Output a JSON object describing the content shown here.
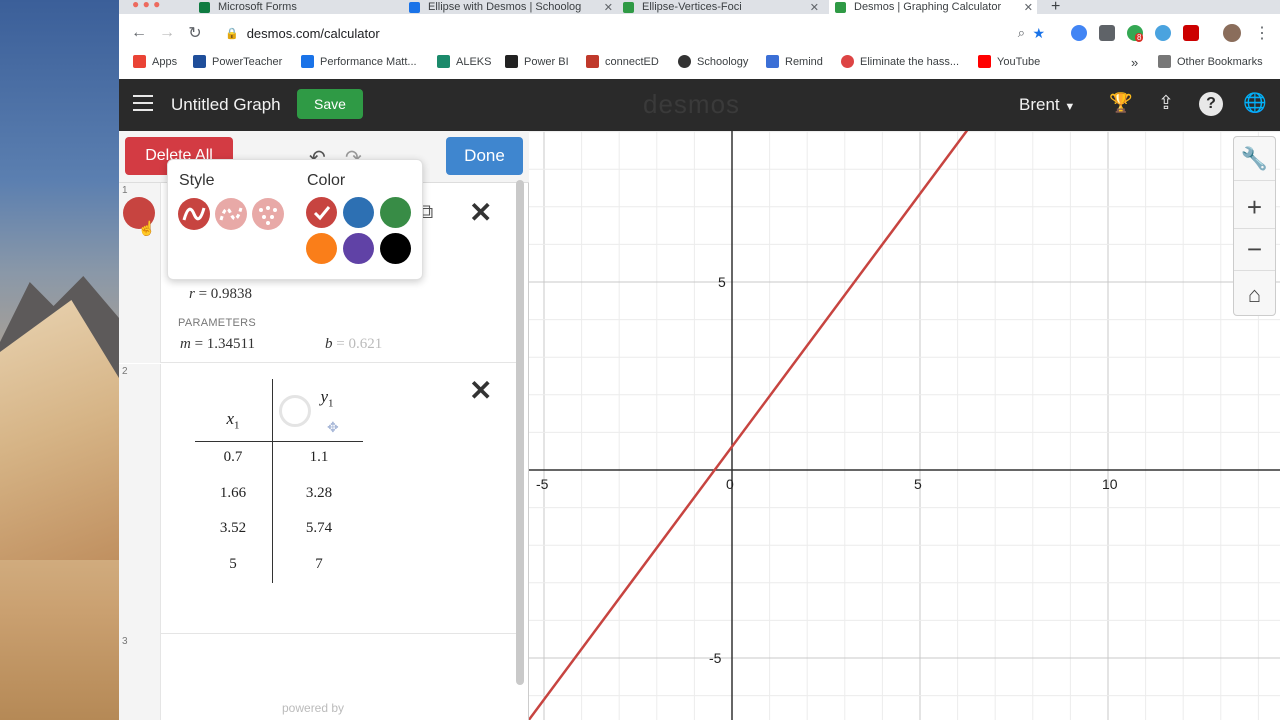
{
  "browser": {
    "tabs": [
      {
        "label": "Microsoft Forms",
        "color": "#0f7b41"
      },
      {
        "label": "Ellipse with Desmos | Schoolog",
        "color": "#1a73e8"
      },
      {
        "label": "Ellipse-Vertices-Foci",
        "color": "#2f9a45"
      },
      {
        "label": "Desmos | Graphing Calculator",
        "color": "#2f9a45"
      }
    ],
    "url": "desmos.com/calculator",
    "bookmarks": [
      {
        "label": "Apps",
        "color": "#ea4335"
      },
      {
        "label": "PowerTeacher",
        "color": "#1f4e9a"
      },
      {
        "label": "Performance Matt...",
        "color": "#1a73e8"
      },
      {
        "label": "ALEKS",
        "color": "#1b8a6b"
      },
      {
        "label": "Power BI",
        "color": "#222222"
      },
      {
        "label": "connectED",
        "color": "#c0392b"
      },
      {
        "label": "Schoology",
        "color": "#333333"
      },
      {
        "label": "Remind",
        "color": "#3b6fd6"
      },
      {
        "label": "Eliminate the hass...",
        "color": "#d44"
      },
      {
        "label": "YouTube",
        "color": "#ff0000"
      }
    ],
    "other_bookmarks": "Other Bookmarks",
    "more": "»",
    "ext_badge": "8"
  },
  "header": {
    "graph_title": "Untitled Graph",
    "save_label": "Save",
    "logo": "desmos",
    "user": "Brent"
  },
  "panel": {
    "delete_all": "Delete All",
    "done": "Done",
    "style_label": "Style",
    "color_label": "Color",
    "colors": [
      "#c74440",
      "#2d70b3",
      "#388c46",
      "#fa7e19",
      "#6042a6",
      "#000000"
    ],
    "expr1": {
      "line_number": "1",
      "r_label": "r",
      "r_value": "= 0.9838",
      "parameters_label": "PARAMETERS",
      "m_label": "m",
      "m_value": "= 1.34511",
      "b_label": "b",
      "b_value": "= 0.621"
    },
    "expr2": {
      "line_number": "2",
      "col_x": "x",
      "col_x_sub": "1",
      "col_y": "y",
      "col_y_sub": "1",
      "rows": [
        [
          "0.7",
          "1.1"
        ],
        [
          "1.66",
          "3.28"
        ],
        [
          "3.52",
          "5.74"
        ],
        [
          "5",
          "7"
        ]
      ]
    },
    "expr3": {
      "line_number": "3"
    },
    "powered_by": "powered by"
  },
  "graph": {
    "x_ticks": [
      "-5",
      "0",
      "5",
      "10"
    ],
    "y_ticks": [
      "5",
      "-5"
    ],
    "line": {
      "slope": 1.34511,
      "intercept": 0.621,
      "color": "#c74440"
    }
  }
}
